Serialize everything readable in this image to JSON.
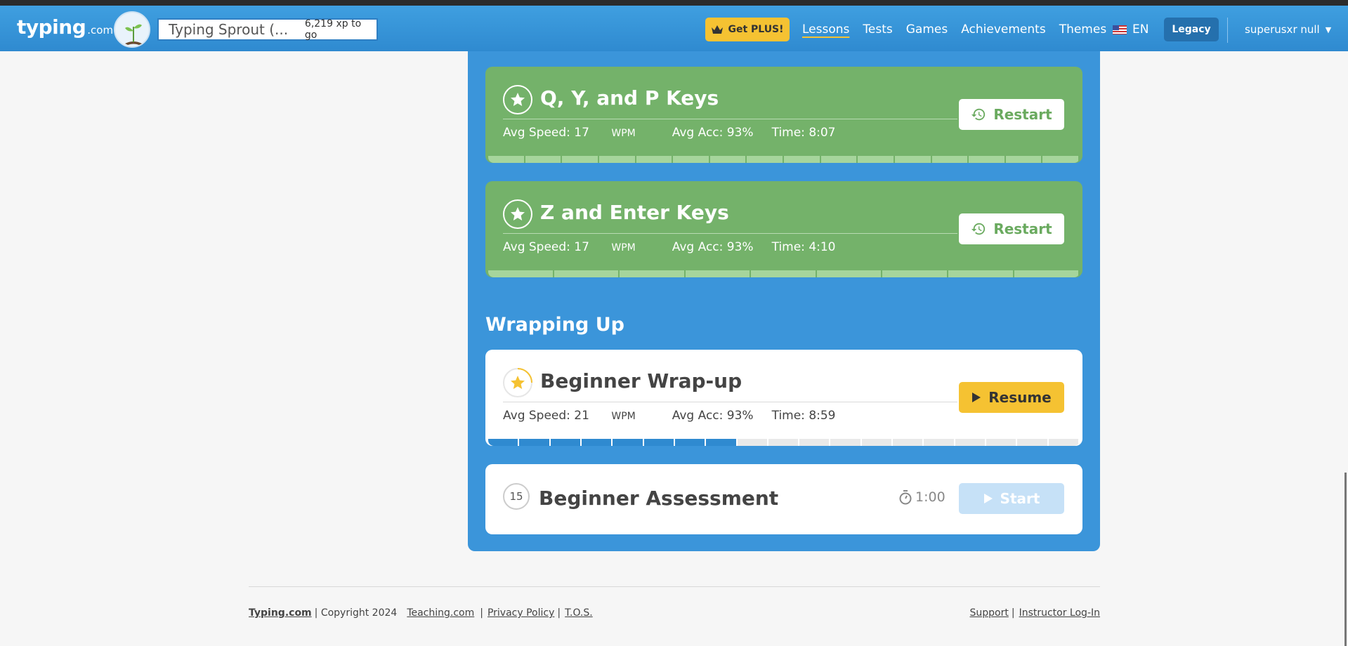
{
  "header": {
    "logo_main": "typing",
    "logo_suffix": ".com",
    "level_name": "Typing Sprout (...",
    "xp_to_go": "6,219 xp to go",
    "plus_label": "Get PLUS!",
    "nav": [
      "Lessons",
      "Tests",
      "Games",
      "Achievements",
      "Themes"
    ],
    "active_nav": "Lessons",
    "language": "EN",
    "legacy_label": "Legacy",
    "username": "superusxr null"
  },
  "lessons": [
    {
      "title": "Q, Y, and P Keys",
      "avg_speed_label": "Avg Speed: 17",
      "wpm_unit": "WPM",
      "avg_acc": "Avg Acc: 93%",
      "time": "Time: 8:07",
      "button": "Restart",
      "status": "complete",
      "segments": 16
    },
    {
      "title": "Z and Enter Keys",
      "avg_speed_label": "Avg Speed: 17",
      "wpm_unit": "WPM",
      "avg_acc": "Avg Acc: 93%",
      "time": "Time: 4:10",
      "button": "Restart",
      "status": "complete",
      "segments": 9
    }
  ],
  "section": {
    "title": "Wrapping Up"
  },
  "wrapup": {
    "title": "Beginner Wrap-up",
    "avg_speed_label": "Avg Speed: 21",
    "wpm_unit": "WPM",
    "avg_acc": "Avg Acc: 93%",
    "time": "Time: 8:59",
    "button": "Resume",
    "segments_total": 19,
    "segments_done": 8
  },
  "assessment": {
    "number": "15",
    "title": "Beginner Assessment",
    "duration": "1:00",
    "button": "Start"
  },
  "footer": {
    "brand": "Typing.com",
    "copyright": "| Copyright 2024",
    "teaching": "Teaching.com",
    "privacy": "Privacy Policy",
    "tos": "T.O.S.",
    "support": "Support",
    "instructor": "Instructor Log-In"
  },
  "colors": {
    "header_blue": "#3f9fe0",
    "panel_blue": "#3b95da",
    "complete_green": "#74b26a",
    "accent_yellow": "#f5c232"
  }
}
